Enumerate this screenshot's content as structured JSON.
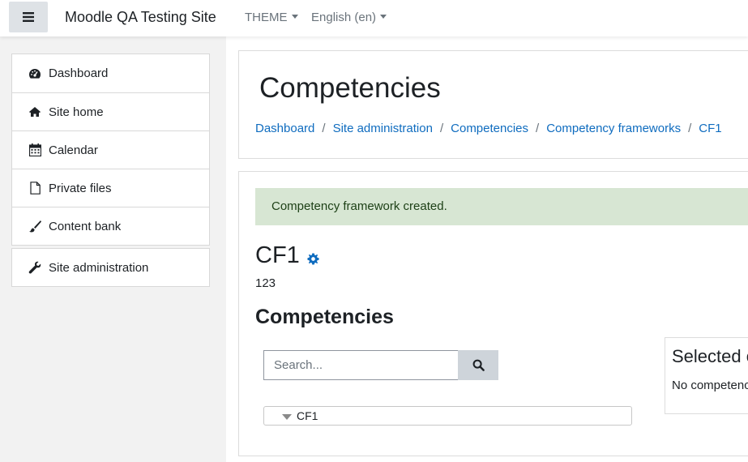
{
  "navbar": {
    "site_name": "Moodle QA Testing Site",
    "theme_label": "THEME",
    "language_label": "English (en)"
  },
  "sidebar": {
    "items": [
      {
        "label": "Dashboard",
        "icon": "dashboard-icon"
      },
      {
        "label": "Site home",
        "icon": "home-icon"
      },
      {
        "label": "Calendar",
        "icon": "calendar-icon"
      },
      {
        "label": "Private files",
        "icon": "file-icon"
      },
      {
        "label": "Content bank",
        "icon": "paintbrush-icon"
      }
    ],
    "admin": {
      "label": "Site administration",
      "icon": "wrench-icon"
    }
  },
  "page": {
    "title": "Competencies",
    "breadcrumb": [
      "Dashboard",
      "Site administration",
      "Competencies",
      "Competency frameworks",
      "CF1"
    ]
  },
  "main": {
    "alert": "Competency framework created.",
    "framework_name": "CF1",
    "framework_description": "123",
    "section_title": "Competencies",
    "search": {
      "placeholder": "Search...",
      "value": ""
    },
    "tree_root": "CF1",
    "selected_panel": {
      "title": "Selected competency",
      "text": "No competency selected"
    }
  },
  "colors": {
    "link": "#0f6cbf",
    "alert_bg": "#d7e6d3",
    "alert_text": "#1c3f15",
    "drawer_bg": "#f2f2f2"
  }
}
